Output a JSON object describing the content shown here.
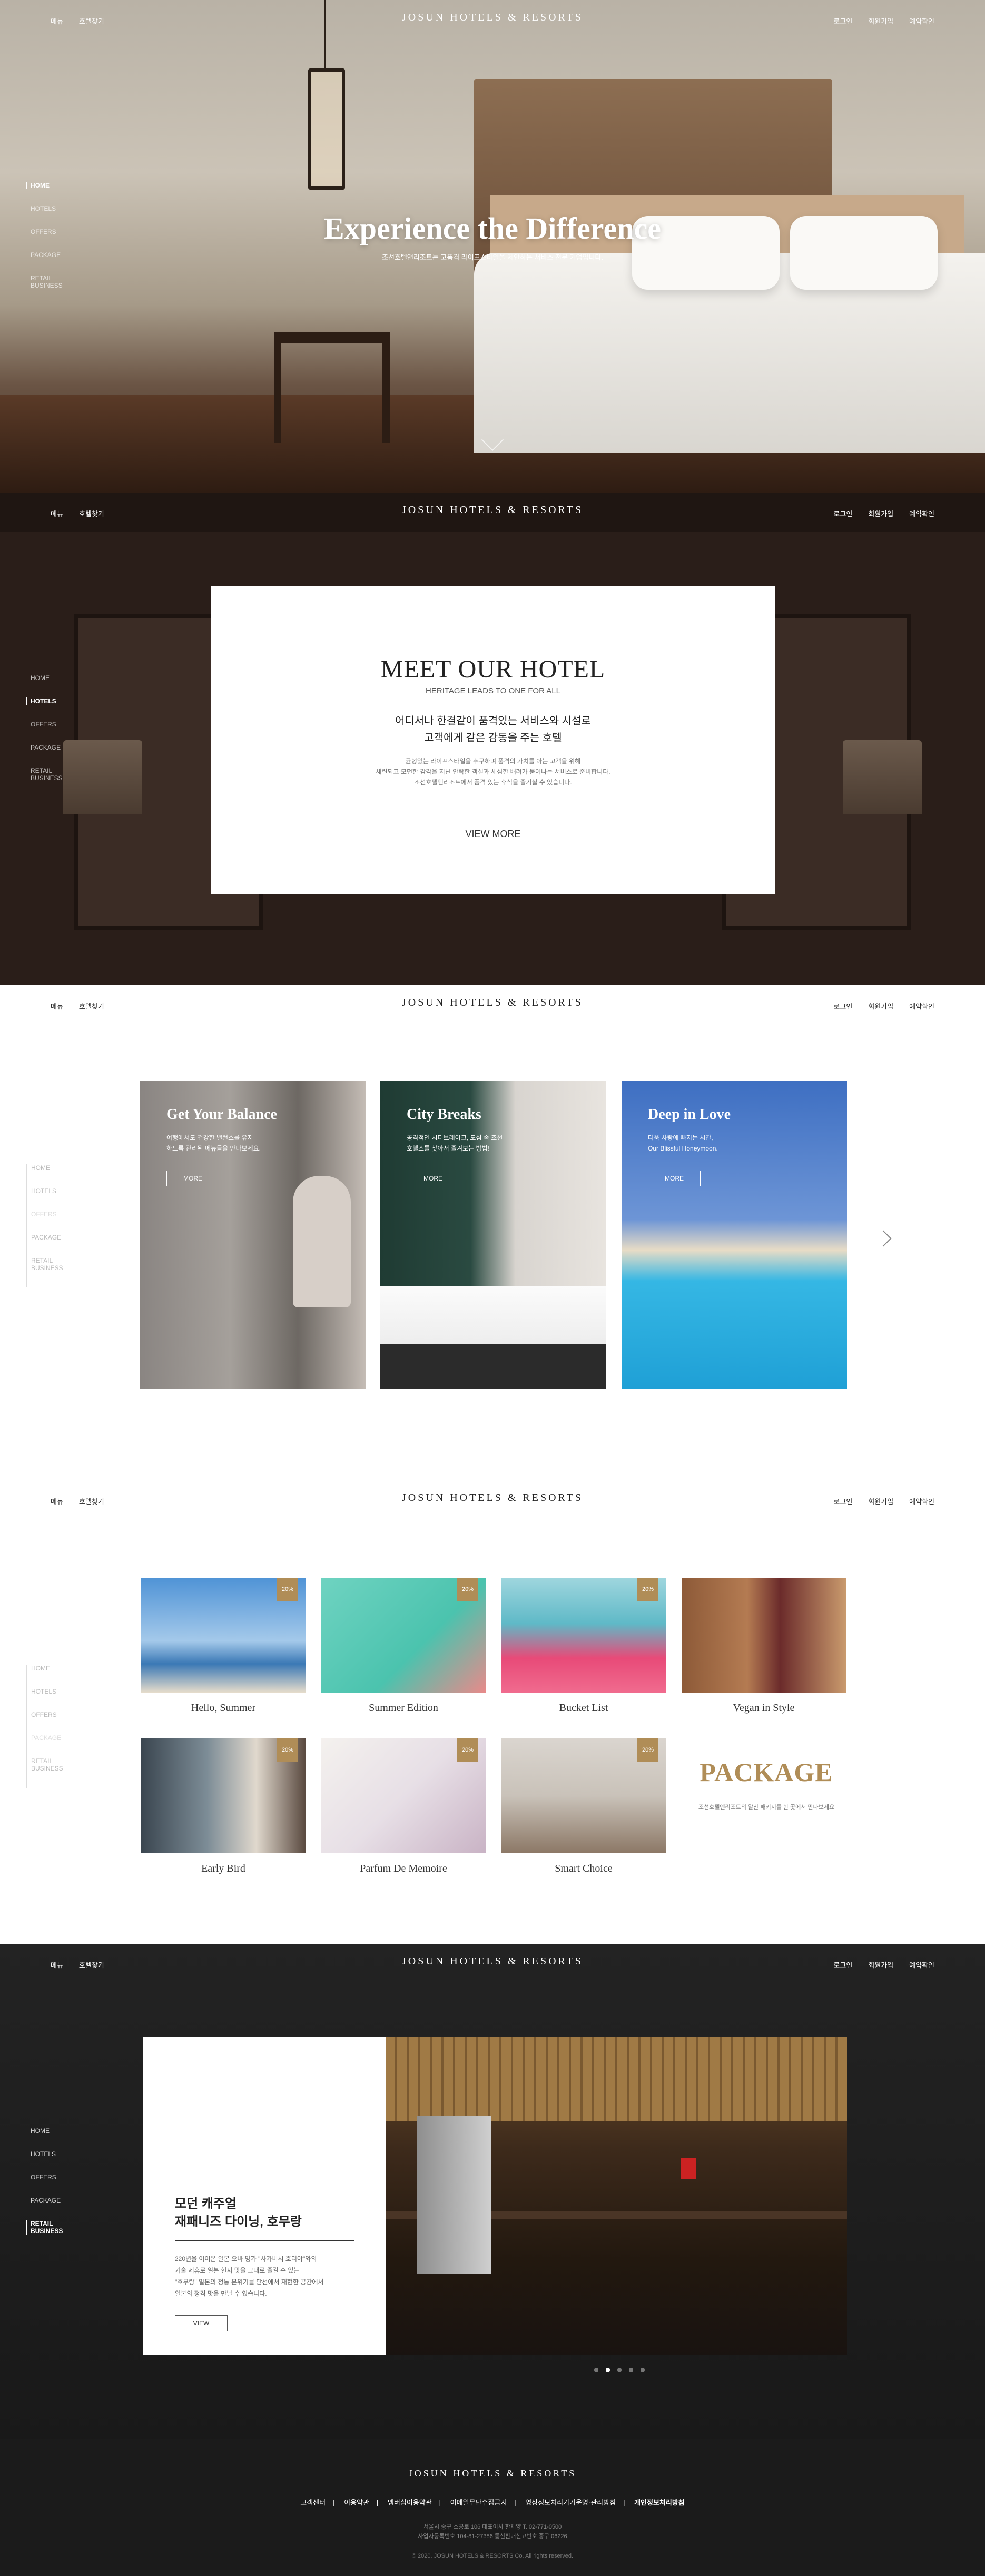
{
  "header": {
    "menu_label": "메뉴",
    "reservation_lookup": "호텔찾기",
    "brand": "JOSUN HOTELS & RESORTS",
    "login": "로그인",
    "join": "회원가입",
    "reservation": "예약확인"
  },
  "sidenav": {
    "items": [
      "HOME",
      "HOTELS",
      "OFFERS",
      "PACKAGE",
      "RETAIL BUSINESS"
    ]
  },
  "hero": {
    "title": "Experience the Difference",
    "subtitle": "조선호텔앤리조트는 고품격 라이프스타일을 제안하는 서비스 전문 기업입니다."
  },
  "meet": {
    "title": "MEET OUR HOTEL",
    "subtitle": "HERITAGE LEADS TO ONE FOR ALL",
    "ko_line1": "어디서나 한결같이 품격있는 서비스와 시설로",
    "ko_line2": "고객에게 같은 감동을 주는 호텔",
    "desc1": "균형있는 라이프스타일을 추구하며 품격의 가치를 아는 고객을 위해",
    "desc2": "세련되고 모던한 감각을 지닌 안락한 객실과 세심한 배려가 묻어나는 서비스로 준비합니다.",
    "desc3": "조선호텔앤리조트에서 품격 있는 휴식을 즐기실 수 있습니다.",
    "more": "VIEW MORE"
  },
  "offers": [
    {
      "title": "Get Your Balance",
      "text1": "여행에서도 건강한 밸런스를 유지",
      "text2": "하도록 관리된 메뉴들을 만나보세요.",
      "button": "MORE"
    },
    {
      "title": "City Breaks",
      "text1": "공격적인 시티브레이크, 도심 속 조선",
      "text2": "호텔스를 찾아서 즐겨보는 방법!",
      "button": "MORE"
    },
    {
      "title": "Deep in Love",
      "text1": "더욱 사랑에 빠지는 시간,",
      "text2": "Our Blissful Honeymoon.",
      "button": "MORE"
    }
  ],
  "packages": {
    "items": [
      {
        "name": "Hello, Summer",
        "badge": "20%"
      },
      {
        "name": "Summer Edition",
        "badge": "20%"
      },
      {
        "name": "Bucket List",
        "badge": "20%"
      },
      {
        "name": "Vegan in Style",
        "badge": ""
      },
      {
        "name": "Early Bird",
        "badge": "20%"
      },
      {
        "name": "Parfum De Memoire",
        "badge": "20%"
      },
      {
        "name": "Smart Choice",
        "badge": "20%"
      }
    ],
    "title": "PACKAGE",
    "desc": "조선호텔앤리조트의 알찬 패키지를 한 곳에서 만나보세요"
  },
  "dining": {
    "heading1": "모던 캐주얼",
    "heading2": "재패니즈 다이닝, 호무랑",
    "p1": "220년을 이어온 일본 오바 명가 \"사카비시 호리야\"와의",
    "p2": "기술 제휴로 일본 현지 맛을 그대로 즐길 수 있는",
    "p3": "\"호무랑\" 일본의 정통 분위기를 단선에서 재현한 공간에서",
    "p4": "일본의 정격 맛을 만날 수 있습니다.",
    "button": "VIEW"
  },
  "footer": {
    "brand": "JOSUN HOTELS & RESORTS",
    "links": [
      "고객센터",
      "이용약관",
      "멤버십이용약관",
      "이메일무단수집금지",
      "영상정보처리기기운영·관리방침",
      "개인정보처리방침"
    ],
    "addr1": "서울시 중구 소공로 106 대표이사 한채양 T. 02-771-0500",
    "addr2": "사업자등록번호 104-81-27386 통신판매신고번호 중구 06226",
    "copy": "© 2020. JOSUN HOTELS & RESORTS Co. All rights reserved."
  },
  "colors": {
    "accent_gold": "#b08d57",
    "footer_bg": "#1b1b1b"
  }
}
